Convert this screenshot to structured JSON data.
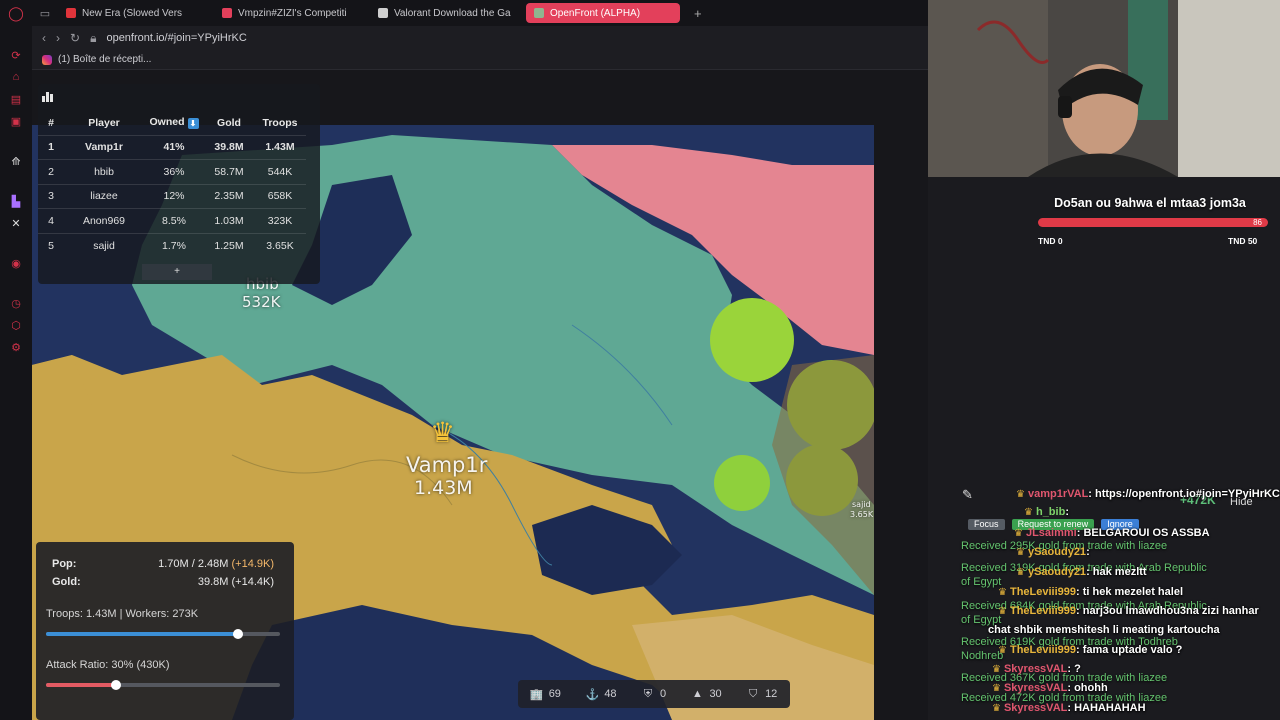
{
  "browser": {
    "tabs": [
      {
        "title": "New Era (Slowed Vers",
        "fav": "#e0343b",
        "active": false
      },
      {
        "title": "Vmpzin#ZIZI's Competiti",
        "fav": "#e3405b",
        "active": false
      },
      {
        "title": "Valorant Download the Ga",
        "fav": "#cfcfcf",
        "active": false
      },
      {
        "title": "OpenFront (ALPHA)",
        "fav": "#8fb58f",
        "active": true
      }
    ],
    "url": "openfront.io/#join=YPyiHrKC",
    "bookmark": "(1) Boîte de récepti..."
  },
  "leaderboard": {
    "headers": [
      "#",
      "Player",
      "Owned",
      "Gold",
      "Troops"
    ],
    "rows": [
      {
        "rank": "1",
        "player": "Vamp1r",
        "owned": "41%",
        "gold": "39.8M",
        "troops": "1.43M"
      },
      {
        "rank": "2",
        "player": "hbib",
        "owned": "36%",
        "gold": "58.7M",
        "troops": "544K"
      },
      {
        "rank": "3",
        "player": "liazee",
        "owned": "12%",
        "gold": "2.35M",
        "troops": "658K"
      },
      {
        "rank": "4",
        "player": "Anon969",
        "owned": "8.5%",
        "gold": "1.03M",
        "troops": "323K"
      },
      {
        "rank": "5",
        "player": "sajid",
        "owned": "1.7%",
        "gold": "1.25M",
        "troops": "3.65K"
      }
    ],
    "expand": "+"
  },
  "map_labels": {
    "vamp_name": "Vamp1r",
    "vamp_troops": "1.43M",
    "hbib_name": "hbib",
    "hbib_troops": "532K",
    "sajid_name": "sajid",
    "sajid_troops": "3.65K"
  },
  "stats": {
    "pop_label": "Pop:",
    "pop_value": "1.70M / 2.48M",
    "pop_delta": "(+14.9K)",
    "gold_label": "Gold:",
    "gold_value": "39.8M (+14.4K)",
    "troops_line": "Troops: 1.43M | Workers: 273K",
    "troops_ratio": 0.82,
    "attack_line": "Attack Ratio: 30% (430K)",
    "attack_ratio": 0.3
  },
  "bottombar": [
    {
      "icon": "city-icon",
      "glyph": "🏢",
      "value": "69"
    },
    {
      "icon": "port-icon",
      "glyph": "⚓",
      "value": "48"
    },
    {
      "icon": "defense-post-icon",
      "glyph": "⛨",
      "value": "0"
    },
    {
      "icon": "missile-silo-icon",
      "glyph": "▲",
      "value": "30"
    },
    {
      "icon": "sam-launcher-icon",
      "glyph": "⛉",
      "value": "12"
    }
  ],
  "poll": {
    "question": "Do5an ou 9ahwa el mtaa3 jom3a",
    "count": "86",
    "left_label": "TND 0",
    "right_label": "TND 50"
  },
  "chat": {
    "rows": [
      {
        "user": "vamp1rVAL",
        "user_color": "#e0566e",
        "msg": ": https://openfront.io#join=YPyiHrKC"
      },
      {
        "user": "h_bib",
        "user_color": "#7fd36a",
        "msg": ":"
      },
      {
        "user": "JLsaimmi",
        "user_color": "#e0566e",
        "msg": ": BELGAROUI OS ASSBA"
      },
      {
        "user": "ySaoudy21",
        "user_color": "#e7b53b",
        "msg": ":"
      },
      {
        "user": "ySaoudy21",
        "user_color": "#e7b53b",
        "msg": ": hak mezltt"
      },
      {
        "user": "TheLeviii999",
        "user_color": "#e7b53b",
        "msg": ": ti hek mezelet halel"
      },
      {
        "user": "TheLeviii999",
        "user_color": "#e7b53b",
        "msg": ": narj3ou lmawdhou3na zizi hanhar"
      },
      {
        "user": "",
        "user_color": "#ffffff",
        "msg": "chat shbik memshitesh li meating kartoucha"
      },
      {
        "user": "TheLeviii999",
        "user_color": "#e7b53b",
        "msg": ": fama uptade valo ?"
      },
      {
        "user": "SkyressVAL",
        "user_color": "#e0566e",
        "msg": ": ?"
      },
      {
        "user": "SkyressVAL",
        "user_color": "#e0566e",
        "msg": ": ohohh"
      },
      {
        "user": "SkyressVAL",
        "user_color": "#e0566e",
        "msg": ": HAHAHAHAH"
      }
    ],
    "system": [
      "Received 295K gold from trade with liazee",
      "Received 319K gold from trade with Arab Republic",
      "of Egypt",
      "Received 684K gold from trade with Arab Republic",
      "of Egypt",
      "Received 619K gold from trade with Todhreb",
      "Nodhreb",
      "Received 367K gold from trade with liazee",
      "Received 472K gold from trade with liazee"
    ],
    "gold_popup": "+472K",
    "hide": "Hide",
    "focus": "Focus",
    "request_renew": "Request to renew",
    "ignore": "Ignore"
  }
}
